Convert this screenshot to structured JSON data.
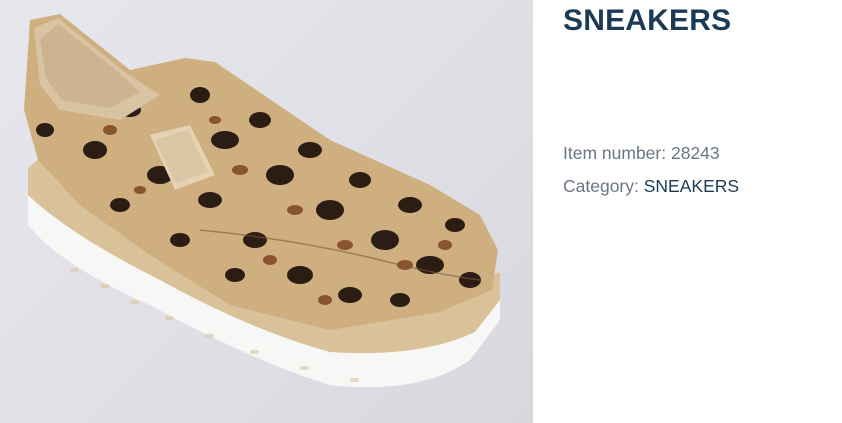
{
  "product": {
    "title": "SNEAKERS",
    "item_number_label": "Item number:",
    "item_number_value": "28243",
    "category_label": "Category:",
    "category_value": "SNEAKERS"
  },
  "colors": {
    "title": "#1b3a56",
    "meta_label": "#6b7585",
    "category_link": "#1b3a56",
    "photo_background": "#e2e3e8"
  }
}
